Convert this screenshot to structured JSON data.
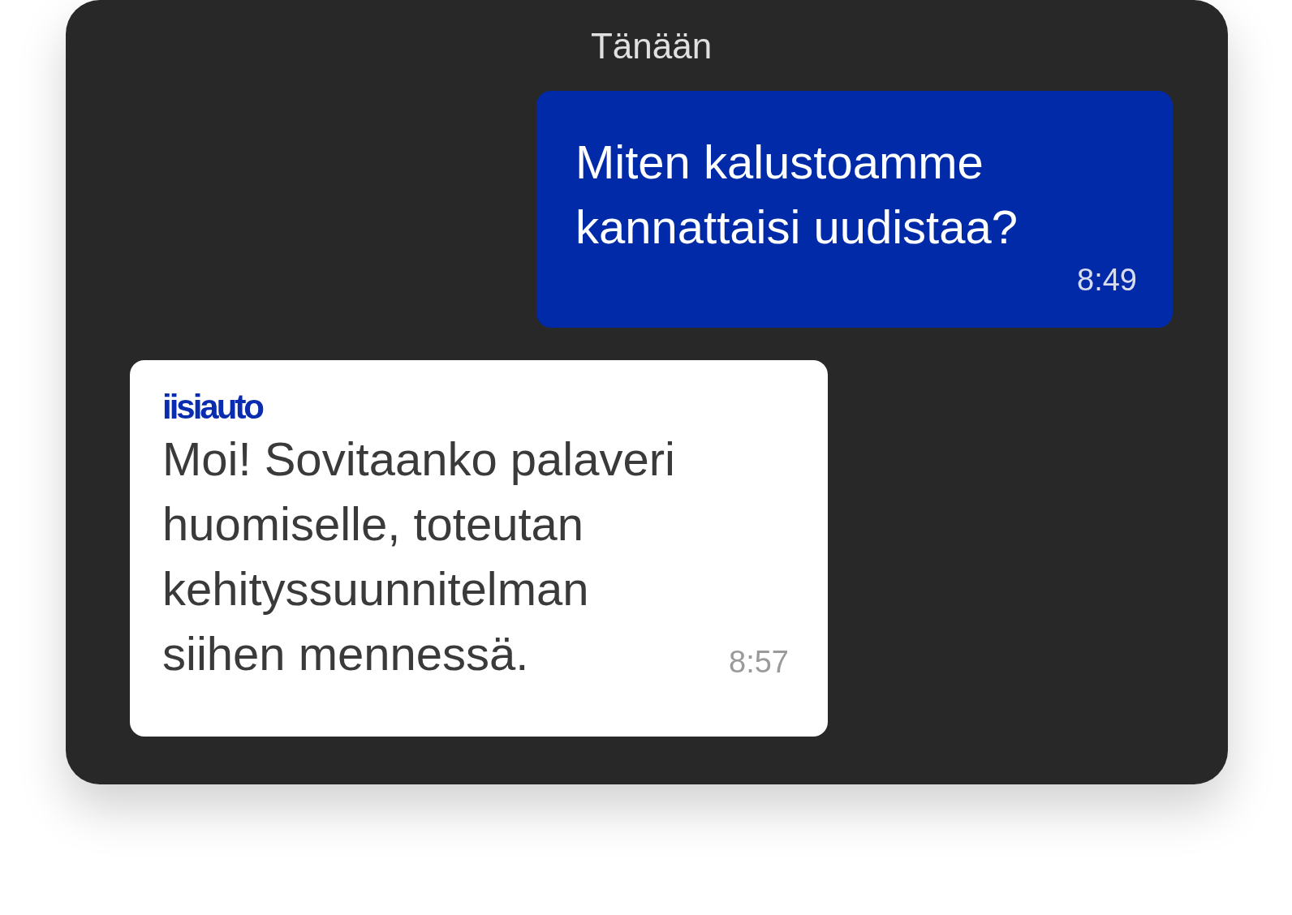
{
  "date_divider": "Tänään",
  "messages": [
    {
      "kind": "outgoing",
      "text": "Miten kalustoamme\nkannattaisi uudistaa?",
      "time": "8:49"
    },
    {
      "kind": "incoming",
      "sender": "iisiauto",
      "text": "Moi! Sovitaanko palaveri\nhuomiselle, toteutan\nkehityssuunnitelman\nsiihen mennessä.",
      "time": "8:57"
    }
  ]
}
